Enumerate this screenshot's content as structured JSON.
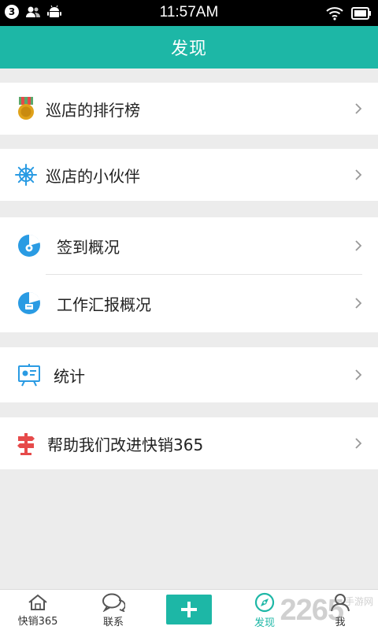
{
  "statusbar": {
    "badge": "3",
    "time": "11:57AM"
  },
  "header": {
    "title": "发现"
  },
  "menu": {
    "ranking": "巡店的排行榜",
    "partners": "巡店的小伙伴",
    "checkin": "签到概况",
    "report": "工作汇报概况",
    "stats": "统计",
    "help": "帮助我们改进快销365"
  },
  "nav": {
    "home": "快销365",
    "contacts": "联系",
    "discover": "发现",
    "me": "我"
  },
  "watermark": {
    "number": "2265",
    "text": "手游网"
  },
  "colors": {
    "accent": "#1db7a6",
    "icon_blue": "#2a9be3",
    "icon_red": "#e64a4a",
    "medal_gold": "#e0a21a"
  }
}
